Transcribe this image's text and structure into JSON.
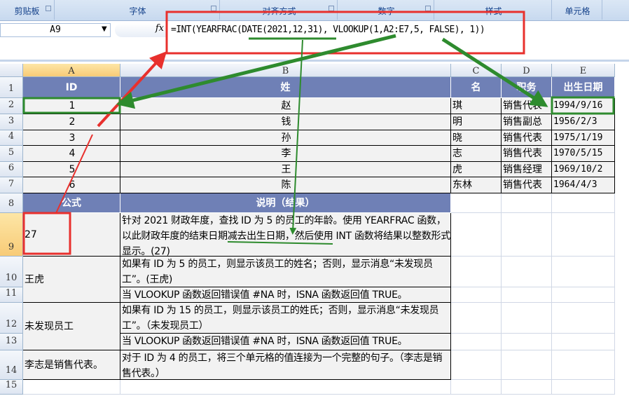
{
  "ribbon": {
    "groups": [
      "剪贴板",
      "字体",
      "对齐方式",
      "数字",
      "样式",
      "单元格"
    ]
  },
  "formula_bar": {
    "name_box": "A9",
    "fx": "fx",
    "formula": "=INT(YEARFRAC(DATE(2021,12,31), VLOOKUP(1,A2:E7,5, FALSE), 1))"
  },
  "columns": [
    "A",
    "B",
    "C",
    "D",
    "E"
  ],
  "rows": [
    "1",
    "2",
    "3",
    "4",
    "5",
    "6",
    "7",
    "8",
    "9",
    "10",
    "11",
    "12",
    "13",
    "14",
    "15"
  ],
  "table": {
    "headers": [
      "ID",
      "姓",
      "名",
      "职务",
      "出生日期"
    ],
    "data": [
      [
        "1",
        "赵",
        "琪",
        "销售代表",
        "1994/9/16"
      ],
      [
        "2",
        "钱",
        "明",
        "销售副总",
        "1956/2/3"
      ],
      [
        "3",
        "孙",
        "晓",
        "销售代表",
        "1975/1/19"
      ],
      [
        "4",
        "李",
        "志",
        "销售代表",
        "1970/5/15"
      ],
      [
        "5",
        "王",
        "虎",
        "销售经理",
        "1969/10/2"
      ],
      [
        "6",
        "陈",
        "东林",
        "销售代表",
        "1964/4/3"
      ]
    ]
  },
  "examples": {
    "headers": [
      "公式",
      "说明（结果）"
    ],
    "r9a": "27",
    "r9b": "针对 2021 财政年度，查找 ID 为 5 的员工的年龄。使用 YEARFRAC 函数，以此财政年度的结束日期减去出生日期，然后使用 INT 函数将结果以整数形式显示。(27)",
    "r10a": "王虎",
    "r10b": "如果有 ID 为 5 的员工，则显示该员工的姓名；否则，显示消息“未发现员工”。(王虎)",
    "r11b": "当 VLOOKUP 函数返回错误值 #NA 时，ISNA 函数返回值 TRUE。",
    "r12a": "未发现员工",
    "r12b": "如果有 ID 为 15 的员工，则显示该员工的姓氏；否则，显示消息“未发现员工”。（未发现员工）",
    "r13b": "当 VLOOKUP 函数返回错误值 #NA 时，ISNA 函数返回值 TRUE。",
    "r14a": "李志是销售代表。",
    "r14b": "对于 ID 为 4 的员工，将三个单元格的值连接为一个完整的句子。（李志是销售代表。）"
  },
  "colors": {
    "header_fill": "#6f80b6",
    "annotation_red": "#e8302d",
    "annotation_green": "#2e8b2e"
  }
}
